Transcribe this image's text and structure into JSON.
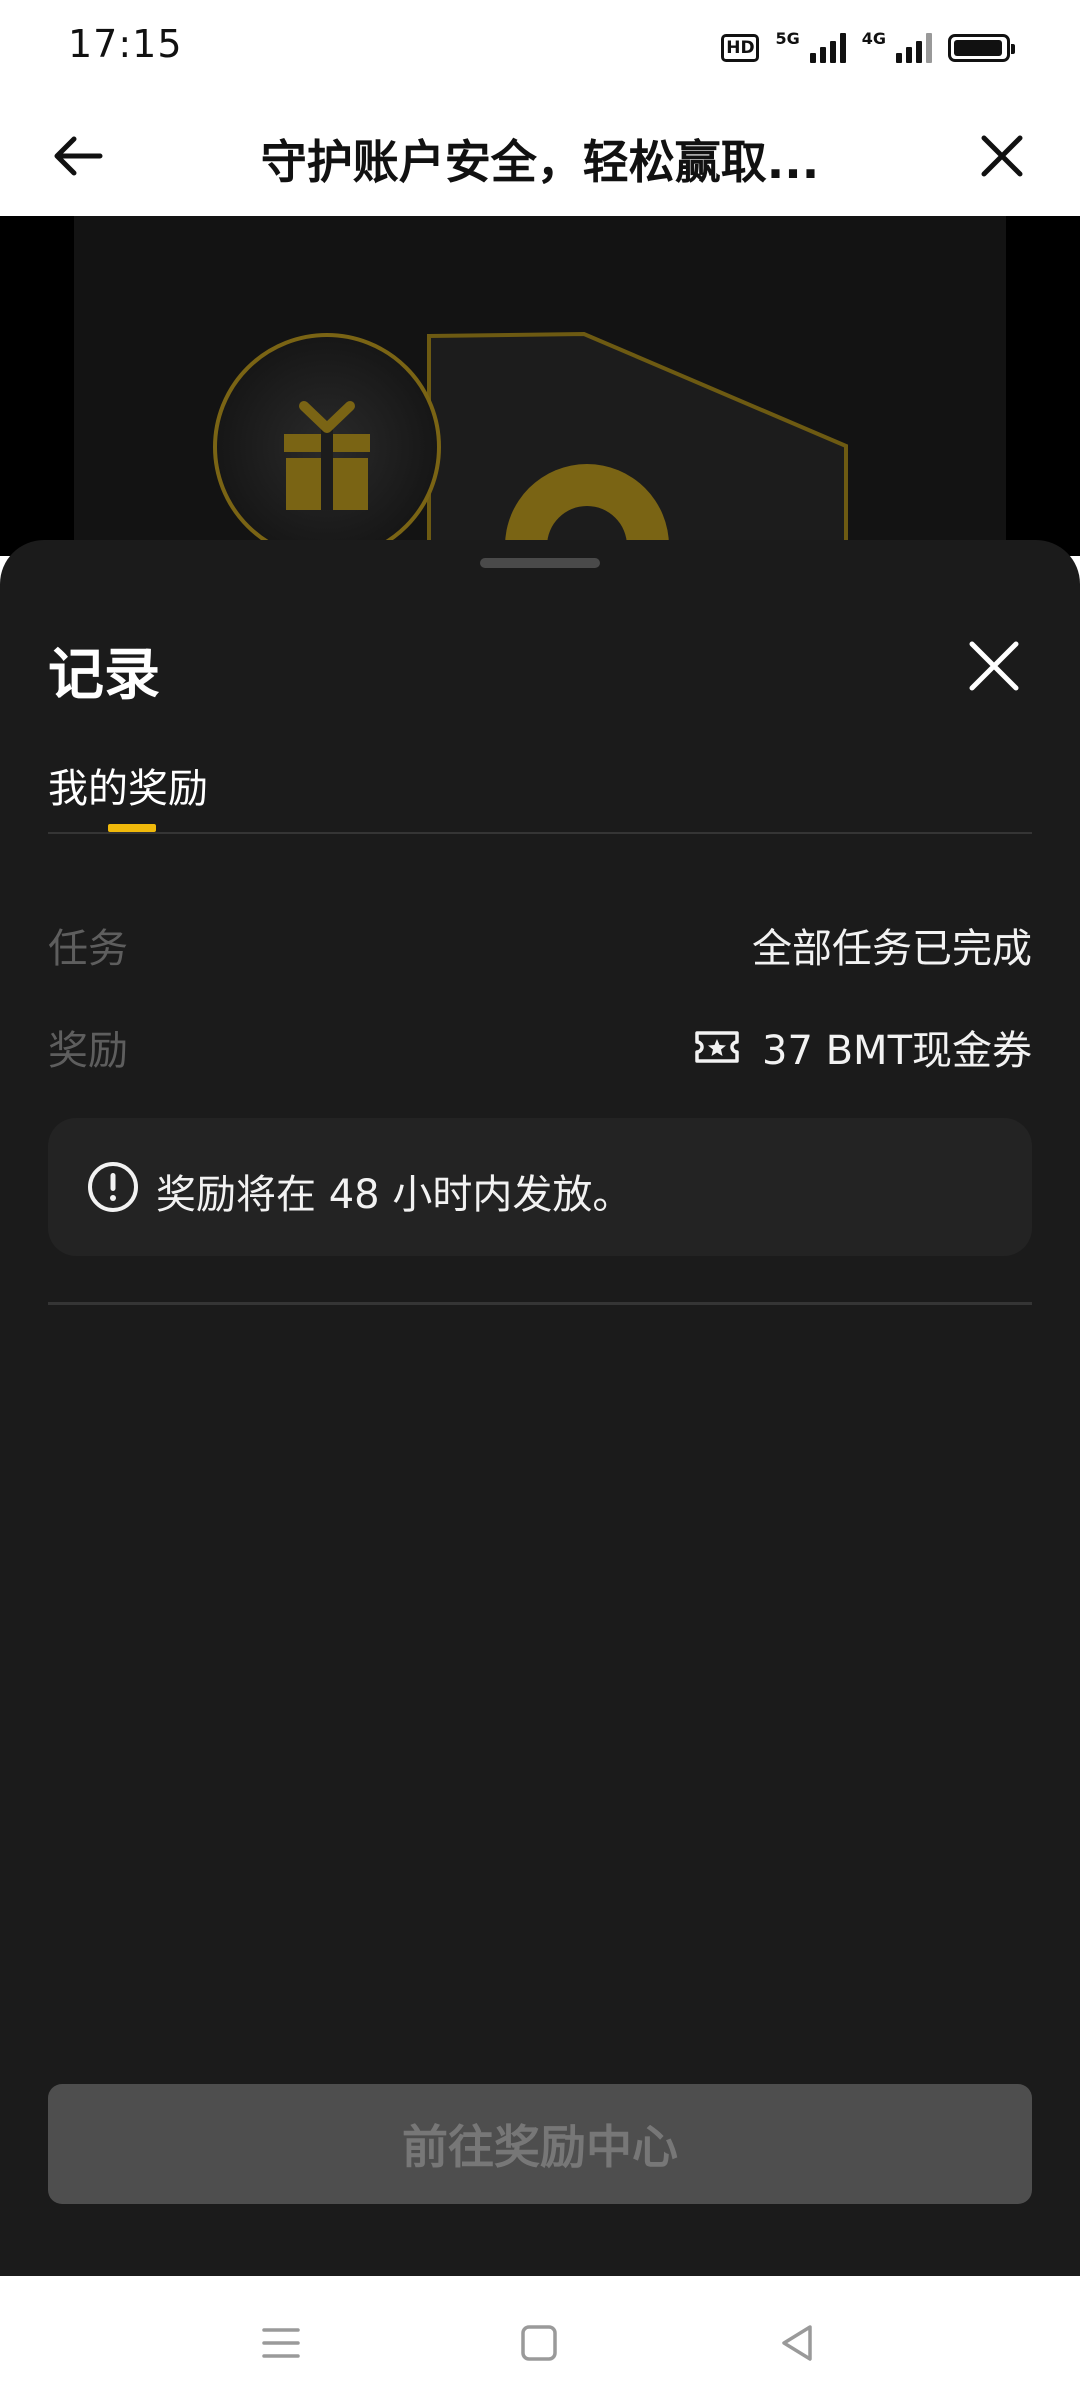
{
  "status_bar": {
    "time": "17:15",
    "hd_label": "HD",
    "network_1": "5G",
    "network_2": "4G",
    "battery_level": 0.95,
    "icons": [
      "hd-icon",
      "signal-5g-icon",
      "signal-4g-icon",
      "battery-icon"
    ]
  },
  "header": {
    "title": "守护账户安全，轻松赢取...",
    "back_icon": "arrow-left-icon",
    "close_icon": "close-icon"
  },
  "sheet": {
    "title": "记录",
    "close_icon": "close-icon",
    "tabs": [
      {
        "label": "我的奖励",
        "active": true
      }
    ],
    "rows": [
      {
        "label": "任务",
        "value": "全部任务已完成"
      },
      {
        "label": "奖励",
        "value": "37 BMT现金券",
        "icon": "ticket-icon"
      }
    ],
    "notice": {
      "icon": "info-icon",
      "text": "奖励将在 48 小时内发放。"
    },
    "primary_button": "前往奖励中心"
  },
  "colors": {
    "accent": "#f0b90b",
    "sheet_bg": "#1b1b1b",
    "notice_bg": "#232323",
    "button_bg": "#4e4e4e"
  },
  "nav_bar": {
    "icons": [
      "menu-icon",
      "home-square-icon",
      "back-triangle-icon"
    ]
  }
}
